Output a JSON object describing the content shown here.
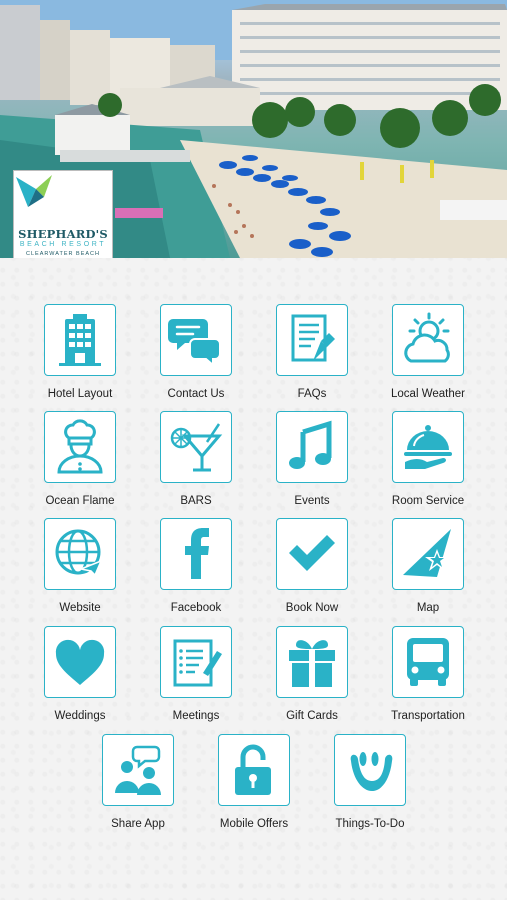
{
  "branding": {
    "name": "SHEPHARD'S",
    "subtitle": "BEACH RESORT",
    "location": "CLEARWATER BEACH"
  },
  "accent_color": "#2ab2c7",
  "menu": [
    {
      "label": "Hotel Layout",
      "icon": "hotel-building-icon"
    },
    {
      "label": "Contact Us",
      "icon": "chat-bubbles-icon"
    },
    {
      "label": "FAQs",
      "icon": "document-pencil-icon"
    },
    {
      "label": "Local Weather",
      "icon": "sun-cloud-icon"
    },
    {
      "label": "Ocean Flame",
      "icon": "chef-icon"
    },
    {
      "label": "BARS",
      "icon": "cocktail-icon"
    },
    {
      "label": "Events",
      "icon": "music-note-icon"
    },
    {
      "label": "Room Service",
      "icon": "cloche-icon"
    },
    {
      "label": "Website",
      "icon": "globe-icon"
    },
    {
      "label": "Facebook",
      "icon": "facebook-icon"
    },
    {
      "label": "Book Now",
      "icon": "checkmark-icon"
    },
    {
      "label": "Map",
      "icon": "map-star-icon"
    },
    {
      "label": "Weddings",
      "icon": "heart-icon"
    },
    {
      "label": "Meetings",
      "icon": "notepad-icon"
    },
    {
      "label": "Gift Cards",
      "icon": "gift-icon"
    },
    {
      "label": "Transportation",
      "icon": "bus-icon"
    },
    {
      "label": "Share App",
      "icon": "share-people-icon"
    },
    {
      "label": "Mobile Offers",
      "icon": "padlock-icon"
    },
    {
      "label": "Things-To-Do",
      "icon": "smile-hand-icon"
    }
  ]
}
